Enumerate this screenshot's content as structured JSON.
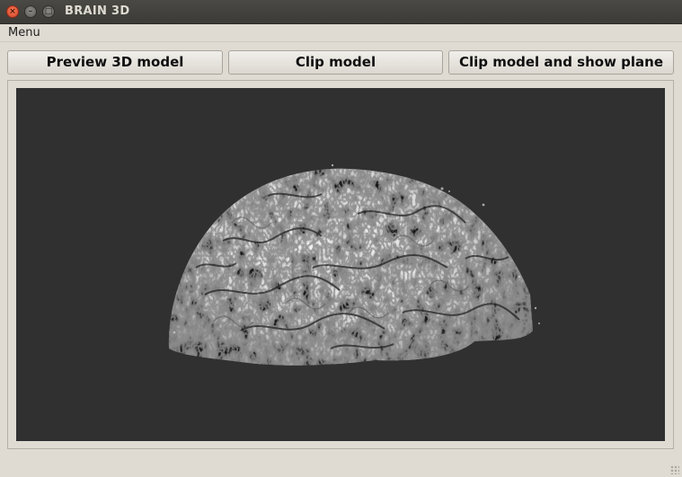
{
  "window": {
    "title": "BRAIN 3D"
  },
  "menubar": {
    "menu_label": "Menu"
  },
  "toolbar": {
    "preview_label": "Preview 3D model",
    "clip_label": "Clip model",
    "clip_show_plane_label": "Clip model and show plane"
  },
  "viewport": {
    "background": "#303030",
    "content": "brain-surface-render"
  },
  "icons": {
    "close": "close-icon",
    "minimize": "minimize-icon",
    "maximize": "maximize-icon"
  }
}
